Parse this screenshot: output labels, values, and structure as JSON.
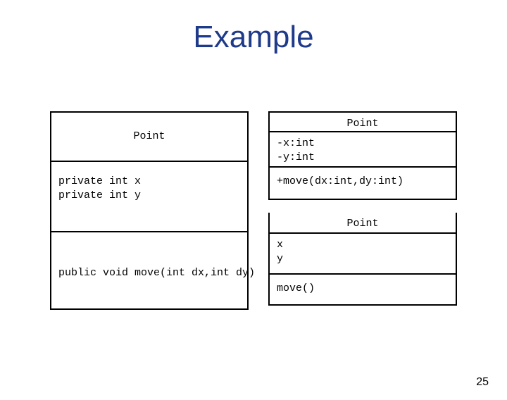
{
  "title": "Example",
  "left": {
    "className": "Point",
    "attributes": "private int x\nprivate int y",
    "operations": "public void move(int dx,int dy)"
  },
  "rightTop": {
    "className": "Point",
    "attributes": "-x:int\n-y:int",
    "operations": "+move(dx:int,dy:int)"
  },
  "rightBottom": {
    "className": "Point",
    "attributes": "x\ny",
    "operations": "move()"
  },
  "pageNumber": "25"
}
